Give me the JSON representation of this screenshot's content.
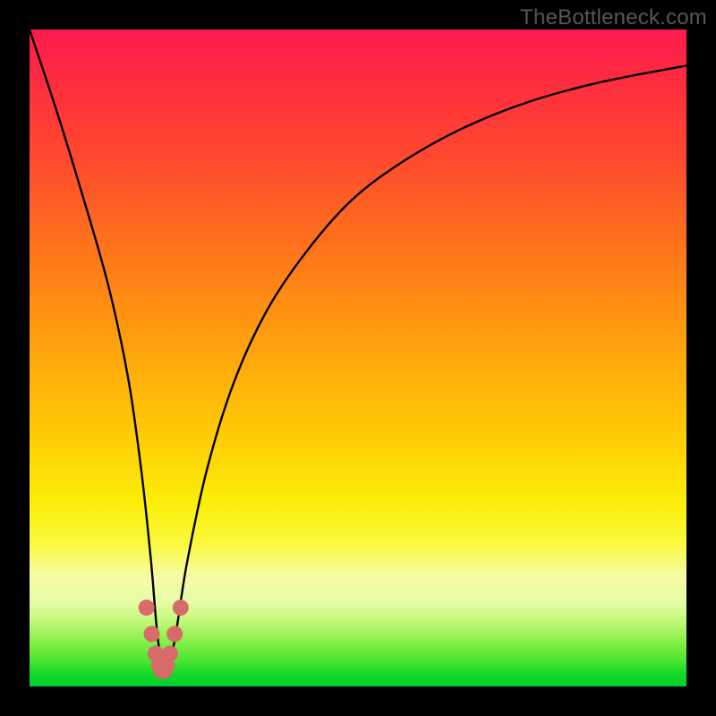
{
  "watermark": "TheBottleneck.com",
  "chart_data": {
    "type": "line",
    "title": "",
    "xlabel": "",
    "ylabel": "",
    "xlim": [
      0,
      100
    ],
    "ylim": [
      0,
      100
    ],
    "series": [
      {
        "name": "curve",
        "x": [
          0,
          4,
          8,
          12,
          15,
          17,
          18.5,
          19.3,
          20.0,
          20.8,
          21.5,
          22.5,
          24,
          27,
          31,
          36,
          42,
          49,
          57,
          66,
          76,
          87,
          100
        ],
        "y_pct": [
          100,
          88,
          75,
          61,
          47,
          33,
          19,
          9.5,
          4.0,
          2.0,
          4.0,
          9.5,
          19,
          33,
          46,
          57,
          66,
          74,
          80,
          85,
          89,
          92,
          94.5
        ]
      }
    ],
    "markers": {
      "name": "minimum-band",
      "color": "#d86a6a",
      "radius_px": 9,
      "points_x": [
        17.8,
        18.6,
        19.2,
        19.7,
        20.1,
        20.5,
        20.9,
        21.4,
        22.1,
        23.0
      ],
      "points_y_pct": [
        12.0,
        8.0,
        5.0,
        3.2,
        2.4,
        2.4,
        3.2,
        5.0,
        8.0,
        12.0
      ]
    }
  }
}
